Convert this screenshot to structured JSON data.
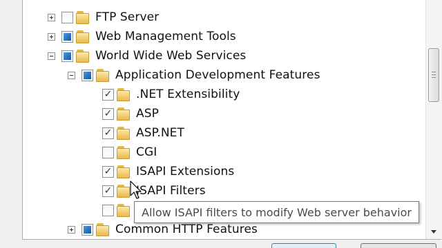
{
  "tree": {
    "items": [
      {
        "label": "FTP Server",
        "expander": "plus",
        "check": "none",
        "indent": 0
      },
      {
        "label": "Web Management Tools",
        "expander": "plus",
        "check": "partial",
        "indent": 0
      },
      {
        "label": "World Wide Web Services",
        "expander": "minus",
        "check": "partial",
        "indent": 0
      },
      {
        "label": "Application Development Features",
        "expander": "minus",
        "check": "partial",
        "indent": 1
      },
      {
        "label": ".NET Extensibility",
        "expander": "none",
        "check": "checked",
        "indent": 2
      },
      {
        "label": "ASP",
        "expander": "none",
        "check": "checked",
        "indent": 2
      },
      {
        "label": "ASP.NET",
        "expander": "none",
        "check": "checked",
        "indent": 2
      },
      {
        "label": "CGI",
        "expander": "none",
        "check": "none",
        "indent": 2
      },
      {
        "label": "ISAPI Extensions",
        "expander": "none",
        "check": "checked",
        "indent": 2
      },
      {
        "label": "ISAPI Filters",
        "expander": "none",
        "check": "checked",
        "indent": 2
      },
      {
        "label": "",
        "expander": "none",
        "check": "none",
        "indent": 2
      },
      {
        "label": "Common HTTP Features",
        "expander": "plus",
        "check": "partial",
        "indent": 1
      }
    ]
  },
  "tooltip": {
    "text": "Allow ISAPI filters to modify Web server behavior"
  },
  "colors": {
    "partial_fill": "#1f6fbf",
    "folder": "#e9b94d",
    "tooltip_border": "#767676"
  },
  "icons": {
    "folder": "folder-icon",
    "expand": "expand-icon",
    "collapse": "collapse-icon",
    "cursor": "mouse-pointer-icon"
  }
}
